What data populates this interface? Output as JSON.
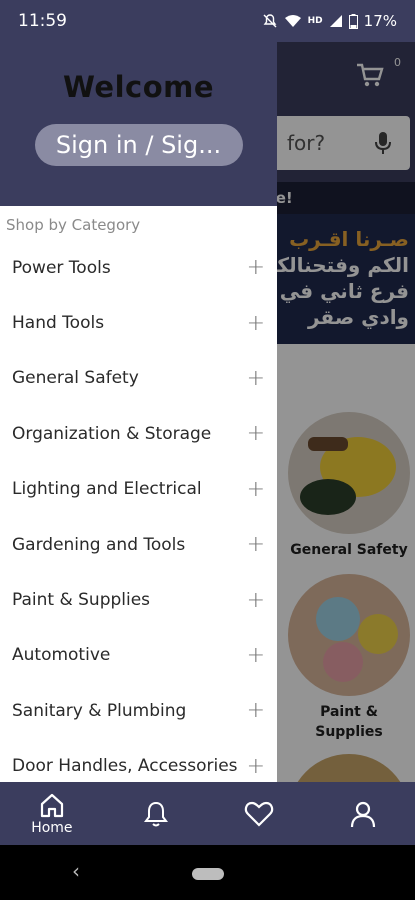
{
  "status": {
    "time": "11:59",
    "network": "HD",
    "battery": "17%"
  },
  "app": {
    "cart_count": "0",
    "search_placeholder": "for?",
    "promo_text": "ore!",
    "banner_lines": [
      "صـرنا اقـرب",
      "الكم وفتحنالكم",
      "فرع ثاني في",
      "وادي صقر"
    ],
    "categories": [
      {
        "label": "General Safety"
      },
      {
        "label": "Paint & Supplies"
      }
    ]
  },
  "drawer": {
    "welcome": "Welcome",
    "signin_label": "Sign in / Sig...",
    "section_title": "Shop by Category",
    "items": [
      {
        "label": "Power Tools"
      },
      {
        "label": "Hand Tools"
      },
      {
        "label": "General Safety"
      },
      {
        "label": "Organization & Storage"
      },
      {
        "label": "Lighting and Electrical"
      },
      {
        "label": "Gardening and Tools"
      },
      {
        "label": "Paint & Supplies"
      },
      {
        "label": "Automotive"
      },
      {
        "label": "Sanitary & Plumbing"
      },
      {
        "label": "Door Handles, Accessories"
      }
    ],
    "plus_symbol": "+"
  },
  "bottomnav": {
    "home_label": "Home"
  },
  "colors": {
    "primary": "#3b3d5e",
    "button": "#8a8ba3",
    "banner_gold": "#e9a53b"
  }
}
